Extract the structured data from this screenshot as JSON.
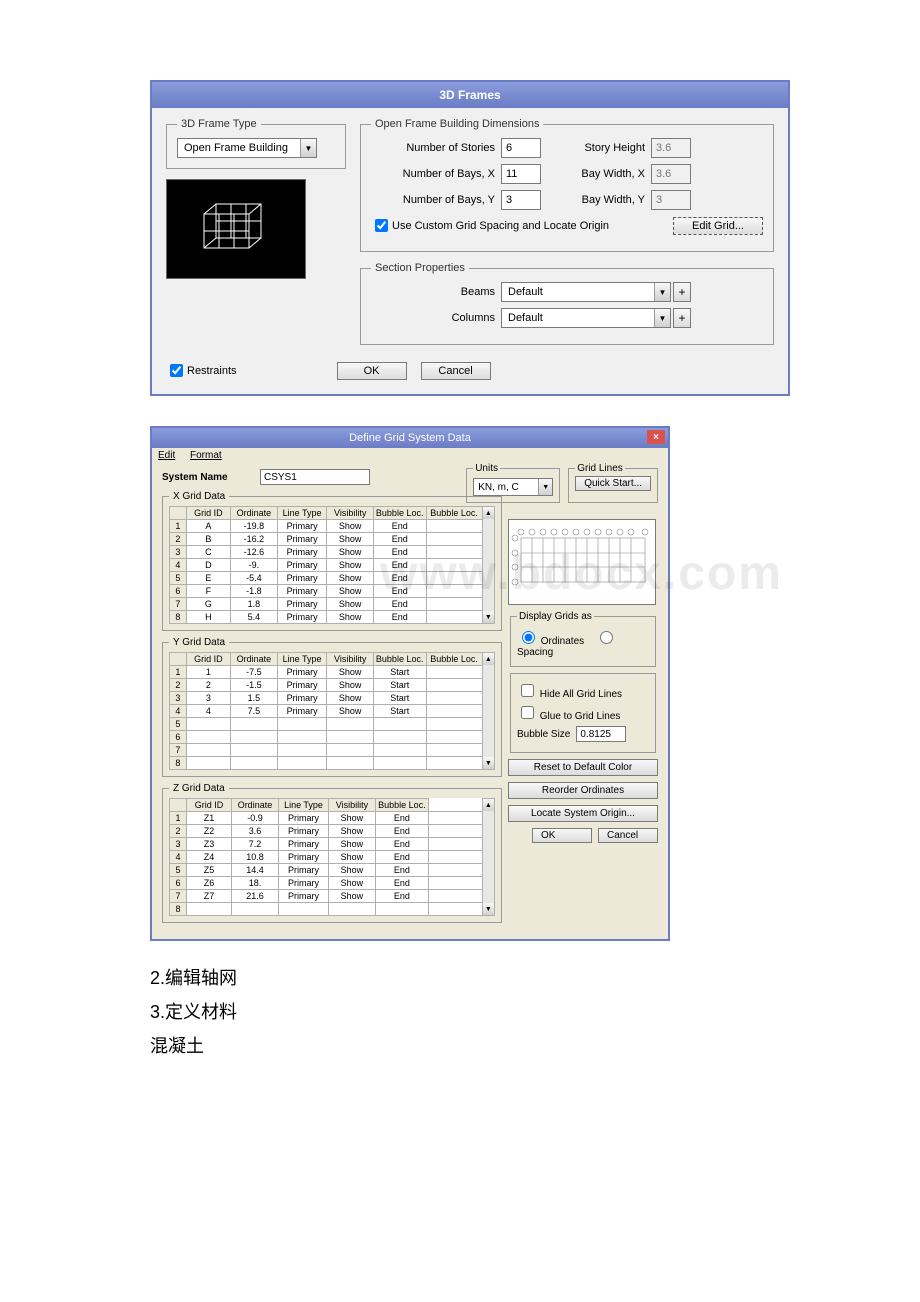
{
  "dlg1": {
    "title": "3D Frames",
    "frame_type": {
      "legend": "3D Frame Type",
      "selected": "Open Frame Building"
    },
    "dims": {
      "legend": "Open Frame Building Dimensions",
      "stories_lbl": "Number of Stories",
      "stories_val": "6",
      "story_h_lbl": "Story Height",
      "story_h_val": "3.6",
      "baysx_lbl": "Number of Bays, X",
      "baysx_val": "11",
      "baywx_lbl": "Bay Width, X",
      "baywx_val": "3.6",
      "baysy_lbl": "Number of Bays, Y",
      "baysy_val": "3",
      "baywy_lbl": "Bay Width, Y",
      "baywy_val": "3",
      "use_custom_lbl": "Use Custom Grid Spacing and Locate Origin",
      "edit_grid_btn": "Edit Grid..."
    },
    "section": {
      "legend": "Section Properties",
      "beams_lbl": "Beams",
      "beams_val": "Default",
      "cols_lbl": "Columns",
      "cols_val": "Default"
    },
    "restraints_lbl": "Restraints",
    "ok": "OK",
    "cancel": "Cancel"
  },
  "dlg2": {
    "title": "Define Grid System Data",
    "menu_edit": "Edit",
    "menu_format": "Format",
    "sysname_lbl": "System Name",
    "sysname_val": "CSYS1",
    "units_legend": "Units",
    "units_val": "KN, m, C",
    "gridlines_legend": "Grid Lines",
    "quick_btn": "Quick Start...",
    "x_legend": "X Grid Data",
    "y_legend": "Y Grid Data",
    "z_legend": "Z Grid Data",
    "headers": [
      "Grid ID",
      "Ordinate",
      "Line Type",
      "Visibility",
      "Bubble Loc.",
      "Bubble Loc."
    ],
    "headers_z": [
      "Grid ID",
      "Ordinate",
      "Line Type",
      "Visibility",
      "Bubble Loc."
    ],
    "x_rows": [
      {
        "n": "1",
        "id": "A",
        "ord": "-19.8",
        "lt": "Primary",
        "vis": "Show",
        "bl": "End"
      },
      {
        "n": "2",
        "id": "B",
        "ord": "-16.2",
        "lt": "Primary",
        "vis": "Show",
        "bl": "End"
      },
      {
        "n": "3",
        "id": "C",
        "ord": "-12.6",
        "lt": "Primary",
        "vis": "Show",
        "bl": "End"
      },
      {
        "n": "4",
        "id": "D",
        "ord": "-9.",
        "lt": "Primary",
        "vis": "Show",
        "bl": "End"
      },
      {
        "n": "5",
        "id": "E",
        "ord": "-5.4",
        "lt": "Primary",
        "vis": "Show",
        "bl": "End"
      },
      {
        "n": "6",
        "id": "F",
        "ord": "-1.8",
        "lt": "Primary",
        "vis": "Show",
        "bl": "End"
      },
      {
        "n": "7",
        "id": "G",
        "ord": "1.8",
        "lt": "Primary",
        "vis": "Show",
        "bl": "End"
      },
      {
        "n": "8",
        "id": "H",
        "ord": "5.4",
        "lt": "Primary",
        "vis": "Show",
        "bl": "End"
      }
    ],
    "y_rows": [
      {
        "n": "1",
        "id": "1",
        "ord": "-7.5",
        "lt": "Primary",
        "vis": "Show",
        "bl": "Start"
      },
      {
        "n": "2",
        "id": "2",
        "ord": "-1.5",
        "lt": "Primary",
        "vis": "Show",
        "bl": "Start"
      },
      {
        "n": "3",
        "id": "3",
        "ord": "1.5",
        "lt": "Primary",
        "vis": "Show",
        "bl": "Start"
      },
      {
        "n": "4",
        "id": "4",
        "ord": "7.5",
        "lt": "Primary",
        "vis": "Show",
        "bl": "Start"
      },
      {
        "n": "5",
        "id": "",
        "ord": "",
        "lt": "",
        "vis": "",
        "bl": ""
      },
      {
        "n": "6",
        "id": "",
        "ord": "",
        "lt": "",
        "vis": "",
        "bl": ""
      },
      {
        "n": "7",
        "id": "",
        "ord": "",
        "lt": "",
        "vis": "",
        "bl": ""
      },
      {
        "n": "8",
        "id": "",
        "ord": "",
        "lt": "",
        "vis": "",
        "bl": ""
      }
    ],
    "z_rows": [
      {
        "n": "1",
        "id": "Z1",
        "ord": "-0.9",
        "lt": "Primary",
        "vis": "Show",
        "bl": "End"
      },
      {
        "n": "2",
        "id": "Z2",
        "ord": "3.6",
        "lt": "Primary",
        "vis": "Show",
        "bl": "End"
      },
      {
        "n": "3",
        "id": "Z3",
        "ord": "7.2",
        "lt": "Primary",
        "vis": "Show",
        "bl": "End"
      },
      {
        "n": "4",
        "id": "Z4",
        "ord": "10.8",
        "lt": "Primary",
        "vis": "Show",
        "bl": "End"
      },
      {
        "n": "5",
        "id": "Z5",
        "ord": "14.4",
        "lt": "Primary",
        "vis": "Show",
        "bl": "End"
      },
      {
        "n": "6",
        "id": "Z6",
        "ord": "18.",
        "lt": "Primary",
        "vis": "Show",
        "bl": "End"
      },
      {
        "n": "7",
        "id": "Z7",
        "ord": "21.6",
        "lt": "Primary",
        "vis": "Show",
        "bl": "End"
      },
      {
        "n": "8",
        "id": "",
        "ord": "",
        "lt": "",
        "vis": "",
        "bl": ""
      }
    ],
    "display_legend": "Display Grids as",
    "radio_ord": "Ordinates",
    "radio_spc": "Spacing",
    "hide_all": "Hide All Grid Lines",
    "glue": "Glue to Grid Lines",
    "bubble_size_lbl": "Bubble Size",
    "bubble_size_val": "0.8125",
    "reset_btn": "Reset to Default Color",
    "reorder_btn": "Reorder Ordinates",
    "locate_btn": "Locate System Origin...",
    "ok": "OK",
    "cancel": "Cancel"
  },
  "watermark": "www.bdocx.com",
  "body_lines": [
    "2.编辑轴网",
    "3.定义材料",
    "混凝土"
  ]
}
